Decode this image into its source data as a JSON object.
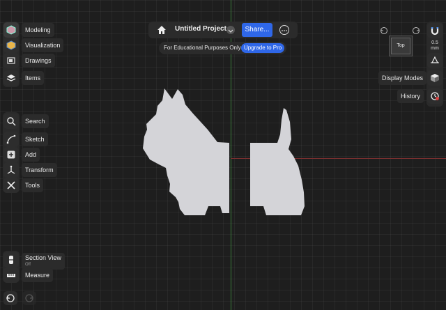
{
  "left_toolbar": {
    "modeling": "Modeling",
    "visualization": "Visualization",
    "drawings": "Drawings",
    "items": "Items",
    "search": "Search",
    "sketch": "Sketch",
    "add": "Add",
    "transform": "Transform",
    "tools": "Tools",
    "section_view": "Section View",
    "section_view_state": "Off",
    "measure": "Measure"
  },
  "header": {
    "project_title": "Untitled Project",
    "share_label": "Share...",
    "notice": "For Educational Purposes Only",
    "upgrade_label": "Upgrade to Pro"
  },
  "right_toolbar": {
    "view_cube_label": "Top",
    "grid_size_value": "0.5",
    "grid_size_unit": "mm",
    "display_modes": "Display Modes",
    "history": "History"
  },
  "colors": {
    "accent": "#2f67e8",
    "canvas": "#1e1e1e",
    "shape_fill": "#d4d4d8",
    "axis_x": "#7a2f2f",
    "axis_y": "#3a7a3a"
  }
}
